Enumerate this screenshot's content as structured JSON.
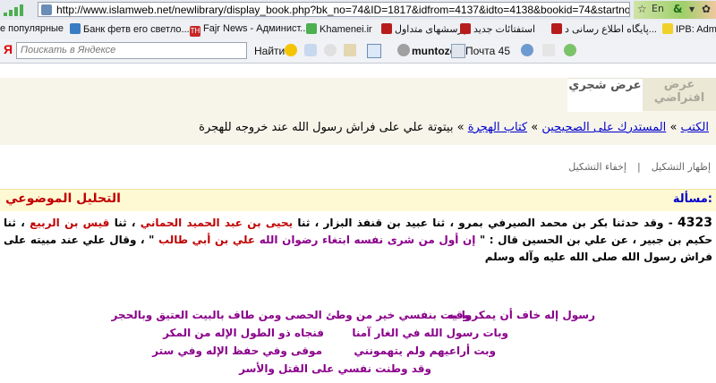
{
  "browser": {
    "url": "http://www.islamweb.net/newlibrary/display_book.php?bk_no=74&ID=1817&idfrom=4137&idto=4138&bookid=74&startno=1",
    "lang": "En"
  },
  "bookmarks": [
    "е популярные",
    "Банк фетв его светло...",
    "Fajr News - Админист...",
    "Khamenei.ir",
    "پرسشهای متداول",
    "استفتائات جديد",
    "پایگاه اطلاع رسانی د...",
    "IPB: Admi"
  ],
  "toolbar": {
    "search_placeholder": "Поискать в Яндексе",
    "find_label": "Найти",
    "user": "muntozor",
    "mail": "Почта 45"
  },
  "tabs": {
    "default": "عرض افتراضي",
    "tree": "عرض شجري"
  },
  "breadcrumb": {
    "b1": "الكتب",
    "b2": "المستدرك على الصحيحين",
    "b3": "كتاب الهجرة",
    "current": "بيتوتة علي على فراش رسول الله عند خروجه للهجرة",
    "sep": "»"
  },
  "tashkeel": {
    "show": "إظهار التشكيل",
    "hide": "إخفاء التشكيل",
    "sep": "|"
  },
  "section": {
    "masala": "مسألة:",
    "tahlil": "التحليل الموضوعي"
  },
  "hadith": {
    "num": "4323",
    "p1": " - وقد حدثنا بكر بن محمد الصيرفي بمرو ، ثنا عبيد بن قنفذ البزار ، ثنا ",
    "n1": "يحيى بن عبد الحميد الحماني",
    "p2": " ، ثنا ",
    "n2": "قيس بن الربيع",
    "p3": " ، ثنا حكيم بن جبير ، عن علي بن الحسين قال : \" ",
    "q1": "إن أول من شرى نفسه ابتغاء رضوان الله",
    "p4": " ",
    "n3": "علي بن أبي طالب",
    "p5": " \" ، وقال علي عند مبيته على فراش رسول الله صلى الله عليه وآله وسلم"
  },
  "poem": {
    "l1a": "وقيت بنفسي خير من وطئ الحصى ومن طاف بالبيت العتيق وبالحجر",
    "l1b": "رسول إله خاف أن يمكروا به",
    "l2a": "فنجاه ذو الطول الإله من المكر",
    "l2b": "وبات رسول الله في الغار آمنا",
    "l3a": "موقى وفي حفظ الإله وفي ستر",
    "l3b": "وبت أراعيهم ولم يتهمونني",
    "l4": "وقد وطنت نفسي على القتل والأسر"
  },
  "colors": {
    "link": "#0000cc",
    "red": "#c00000",
    "purple": "#8a008a",
    "panel": "#f7f5ea"
  }
}
